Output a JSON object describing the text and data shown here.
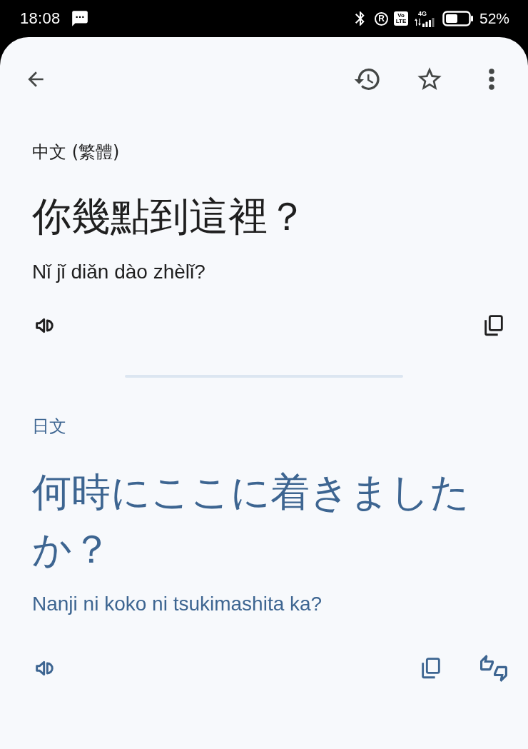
{
  "status_bar": {
    "time": "18:08",
    "roaming_label": "R",
    "volte_label": "Vo LTE",
    "network_type": "4G",
    "battery": "52%"
  },
  "source": {
    "language": "中文 (繁體)",
    "text": "你幾點到這裡？",
    "transliteration": "Nǐ jǐ diǎn dào zhèlǐ?"
  },
  "target": {
    "language": "日文",
    "text": "何時にここに着きましたか？",
    "transliteration": "Nanji ni koko ni tsukimashita ka?"
  }
}
